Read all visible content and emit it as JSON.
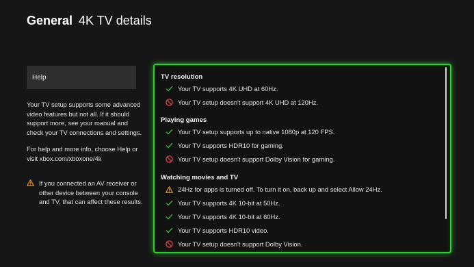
{
  "header": {
    "section": "General",
    "page": "4K TV details"
  },
  "sidebar": {
    "help_label": "Help",
    "para1": "Your TV setup supports some advanced video features but not all. If it should support more, see your manual and check your TV connections and settings.",
    "para2": "For help and more info, choose Help or visit xbox.com/xboxone/4k",
    "warning": "If you connected an AV receiver or other device between your console and TV, that can affect these results."
  },
  "panel": {
    "tv_resolution": {
      "title": "TV resolution",
      "items": [
        {
          "status": "check",
          "text": "Your TV supports 4K UHD at 60Hz."
        },
        {
          "status": "no",
          "text": "Your TV setup doesn't support 4K UHD at 120Hz."
        }
      ]
    },
    "playing_games": {
      "title": "Playing games",
      "items": [
        {
          "status": "check",
          "text": "Your TV setup supports up to native 1080p at 120 FPS."
        },
        {
          "status": "check",
          "text": "Your TV supports HDR10 for gaming."
        },
        {
          "status": "no",
          "text": "Your TV setup doesn't support Dolby Vision for gaming."
        }
      ]
    },
    "watching": {
      "title": "Watching movies and TV",
      "items": [
        {
          "status": "warning",
          "text": "24Hz for apps is turned off. To turn it on, back up and select Allow 24Hz."
        },
        {
          "status": "check",
          "text": "Your TV supports 4K 10-bit at 50Hz."
        },
        {
          "status": "check",
          "text": "Your TV supports 4K 10-bit at 60Hz."
        },
        {
          "status": "check",
          "text": "Your TV supports HDR10 video."
        },
        {
          "status": "no",
          "text": "Your TV setup doesn't support Dolby Vision."
        }
      ]
    }
  },
  "colors": {
    "accent": "#2dd22d",
    "check": "#3cc43c",
    "no": "#e0443c",
    "warning": "#e8922a"
  }
}
